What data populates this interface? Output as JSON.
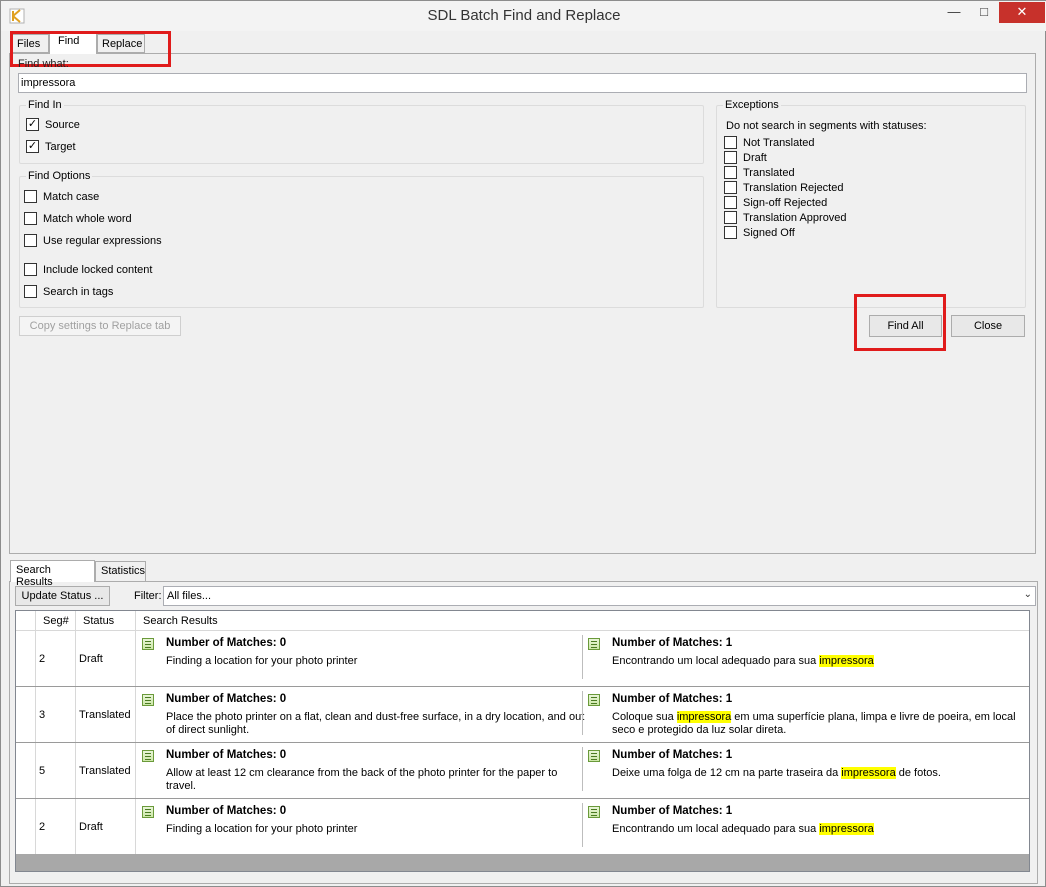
{
  "window": {
    "title": "SDL Batch Find and Replace",
    "minimize": "—",
    "maximize": "□",
    "close": "✕"
  },
  "tabs": {
    "files": "Files",
    "find": "Find",
    "replace": "Replace"
  },
  "find": {
    "label": "Find what:",
    "value": "impressora",
    "find_in_title": "Find In",
    "source_label": "Source",
    "target_label": "Target",
    "options_title": "Find Options",
    "match_case": "Match case",
    "match_whole_word": "Match whole word",
    "use_regex": "Use regular expressions",
    "include_locked": "Include locked content",
    "search_in_tags": "Search in tags"
  },
  "exceptions": {
    "title": "Exceptions",
    "note": "Do not search in segments with statuses:",
    "statuses": [
      "Not Translated",
      "Draft",
      "Translated",
      "Translation Rejected",
      "Sign-off Rejected",
      "Translation Approved",
      "Signed Off"
    ]
  },
  "buttons": {
    "copy_settings": "Copy settings to Replace tab",
    "find_all": "Find All",
    "close": "Close",
    "update_status": "Update Status ..."
  },
  "bottom_tabs": {
    "results": "Search Results",
    "statistics": "Statistics"
  },
  "filter": {
    "label": "Filter:",
    "value": "All files..."
  },
  "grid": {
    "headers": {
      "seg": "Seg#",
      "status": "Status",
      "results": "Search Results"
    },
    "rows": [
      {
        "seg": "2",
        "status": "Draft",
        "src_head": "Number of Matches: 0",
        "src_text": "Finding a location for your photo printer",
        "tgt_head": "Number of Matches: 1",
        "tgt_pre": "Encontrando um local adequado para sua ",
        "tgt_hl": "impressora",
        "tgt_post": ""
      },
      {
        "seg": "3",
        "status": "Translated",
        "src_head": "Number of Matches: 0",
        "src_text": "Place the photo printer on a flat, clean and dust-free surface, in a dry location, and out of direct sunlight.",
        "tgt_head": "Number of Matches: 1",
        "tgt_pre": "Coloque sua ",
        "tgt_hl": "impressora",
        "tgt_post": " em uma superfície plana, limpa e livre de poeira, em local seco e protegido da luz solar direta."
      },
      {
        "seg": "5",
        "status": "Translated",
        "src_head": "Number of Matches: 0",
        "src_text": "Allow at least 12 cm clearance from the back of the photo printer for the paper to travel.",
        "tgt_head": "Number of Matches: 1",
        "tgt_pre": "Deixe uma folga de 12 cm na parte traseira da ",
        "tgt_hl": "impressora",
        "tgt_post": " de fotos."
      },
      {
        "seg": "2",
        "status": "Draft",
        "src_head": "Number of Matches: 0",
        "src_text": "Finding a location for your photo printer",
        "tgt_head": "Number of Matches: 1",
        "tgt_pre": "Encontrando um local adequado para sua ",
        "tgt_hl": "impressora",
        "tgt_post": ""
      }
    ]
  },
  "colors": {
    "highlight": "#ffff00",
    "annotation_red": "#e01b1b",
    "close_button": "#c7312b"
  }
}
